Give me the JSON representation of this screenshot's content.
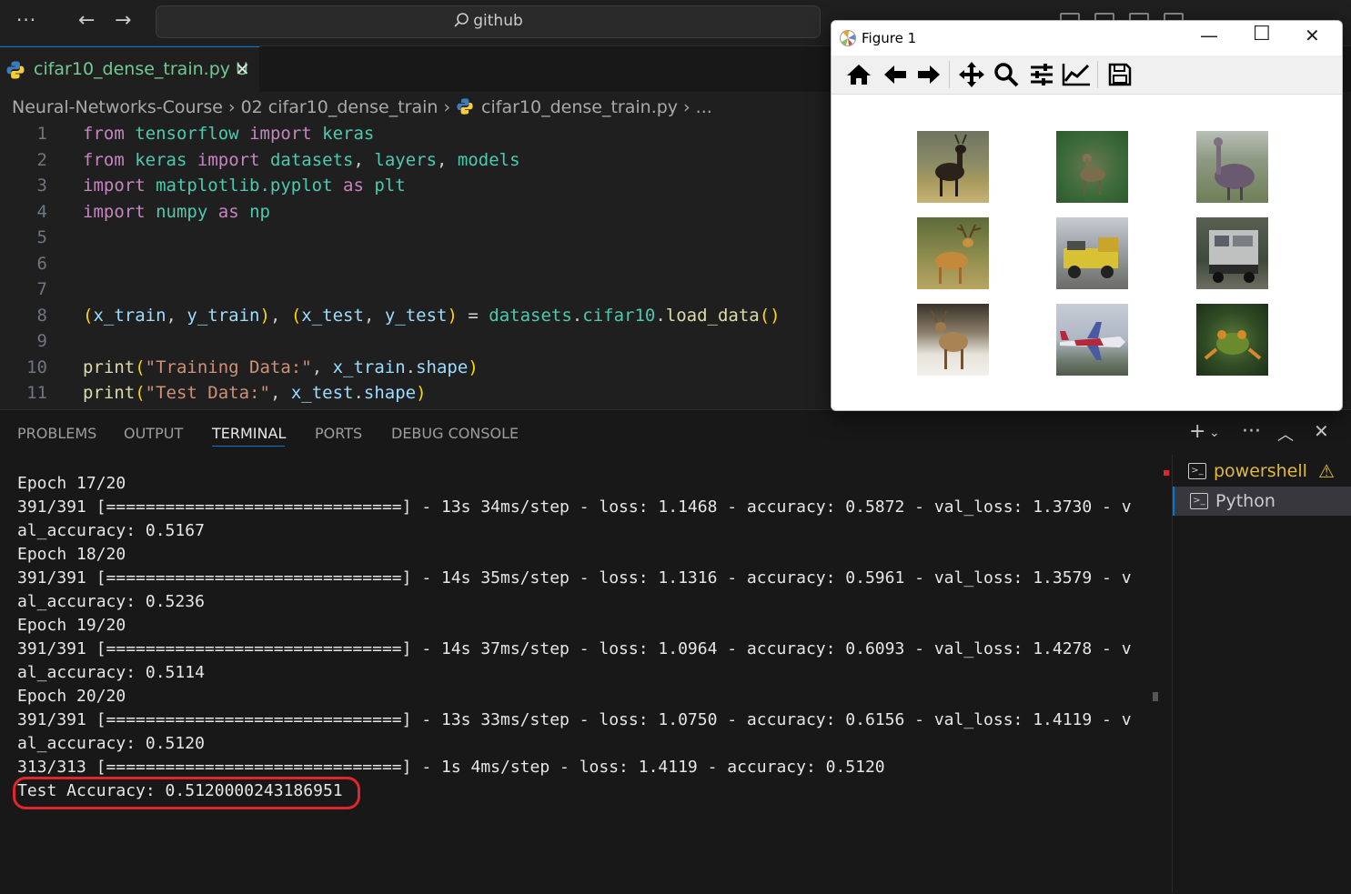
{
  "titlebar": {
    "search_text": "github",
    "menu_icon": "more-icon",
    "back_icon": "arrow-left-icon",
    "forward_icon": "arrow-right-icon"
  },
  "editor_tab": {
    "filename": "cifar10_dense_train.py",
    "status": "U",
    "close": "✕"
  },
  "breadcrumb": {
    "items": [
      "Neural-Networks-Course",
      "02 cifar10_dense_train",
      "cifar10_dense_train.py",
      "..."
    ]
  },
  "code": {
    "line_numbers": [
      "1",
      "2",
      "3",
      "4",
      "5",
      "6",
      "7",
      "8",
      "9",
      "10",
      "11"
    ]
  },
  "panel": {
    "tabs": [
      "PROBLEMS",
      "OUTPUT",
      "TERMINAL",
      "PORTS",
      "DEBUG CONSOLE"
    ],
    "active_tab": "TERMINAL"
  },
  "terminal": {
    "lines": [
      "Epoch 17/20",
      "391/391 [==============================] - 13s 34ms/step - loss: 1.1468 - accuracy: 0.5872 - val_loss: 1.3730 - v",
      "al_accuracy: 0.5167",
      "Epoch 18/20",
      "391/391 [==============================] - 14s 35ms/step - loss: 1.1316 - accuracy: 0.5961 - val_loss: 1.3579 - v",
      "al_accuracy: 0.5236",
      "Epoch 19/20",
      "391/391 [==============================] - 14s 37ms/step - loss: 1.0964 - accuracy: 0.6093 - val_loss: 1.4278 - v",
      "al_accuracy: 0.5114",
      "Epoch 20/20",
      "391/391 [==============================] - 13s 33ms/step - loss: 1.0750 - accuracy: 0.6156 - val_loss: 1.4119 - v",
      "al_accuracy: 0.5120",
      "313/313 [==============================] - 1s 4ms/step - loss: 1.4119 - accuracy: 0.5120",
      "Test Accuracy: 0.5120000243186951"
    ]
  },
  "terminal_list": {
    "items": [
      {
        "label": "powershell",
        "warning": true
      },
      {
        "label": "Python",
        "warning": false
      }
    ]
  },
  "figure": {
    "title": "Figure 1",
    "toolbar": [
      "home-icon",
      "back-icon",
      "forward-icon",
      "pan-icon",
      "zoom-icon",
      "configure-subplots-icon",
      "edit-axis-icon",
      "save-icon"
    ]
  },
  "colors": {
    "accent": "#0078d4",
    "highlight": "#e0262b",
    "untracked": "#73c991",
    "warning": "#e2b93d"
  }
}
